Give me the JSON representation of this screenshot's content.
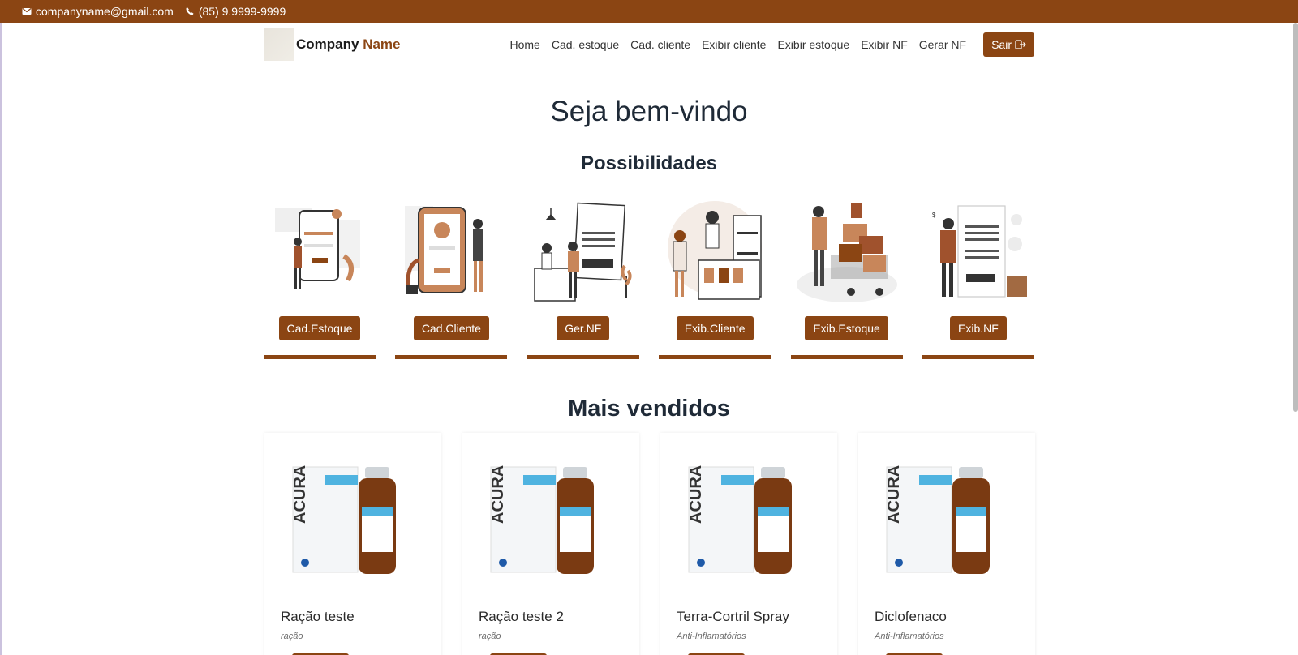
{
  "topbar": {
    "email": "companyname@gmail.com",
    "phone": "(85) 9.9999-9999"
  },
  "brand": {
    "name_main": "Company",
    "name_accent": "Name"
  },
  "nav": {
    "links": [
      "Home",
      "Cad. estoque",
      "Cad. cliente",
      "Exibir cliente",
      "Exibir estoque",
      "Exibir NF",
      "Gerar NF"
    ],
    "logout": "Sair"
  },
  "hero": {
    "title": "Seja bem-vindo",
    "subtitle": "Possibilidades"
  },
  "features": [
    {
      "label": "Cad.Estoque",
      "icon": "mobile-login-illustration"
    },
    {
      "label": "Cad.Cliente",
      "icon": "welcome-profile-illustration"
    },
    {
      "label": "Ger.NF",
      "icon": "store-receipt-illustration"
    },
    {
      "label": "Exib.Cliente",
      "icon": "shop-counter-illustration"
    },
    {
      "label": "Exib.Estoque",
      "icon": "warehouse-boxes-illustration"
    },
    {
      "label": "Exib.NF",
      "icon": "receipt-invoice-illustration"
    }
  ],
  "best_sellers": {
    "title": "Mais vendidos",
    "products": [
      {
        "name": "Ração teste",
        "category": "ração"
      },
      {
        "name": "Ração teste 2",
        "category": "ração"
      },
      {
        "name": "Terra-Cortril Spray",
        "category": "Anti-Inflamatórios"
      },
      {
        "name": "Diclofenaco",
        "category": "Anti-Inflamatórios"
      }
    ]
  },
  "colors": {
    "accent": "#8b4513",
    "text": "#1f2a37"
  }
}
